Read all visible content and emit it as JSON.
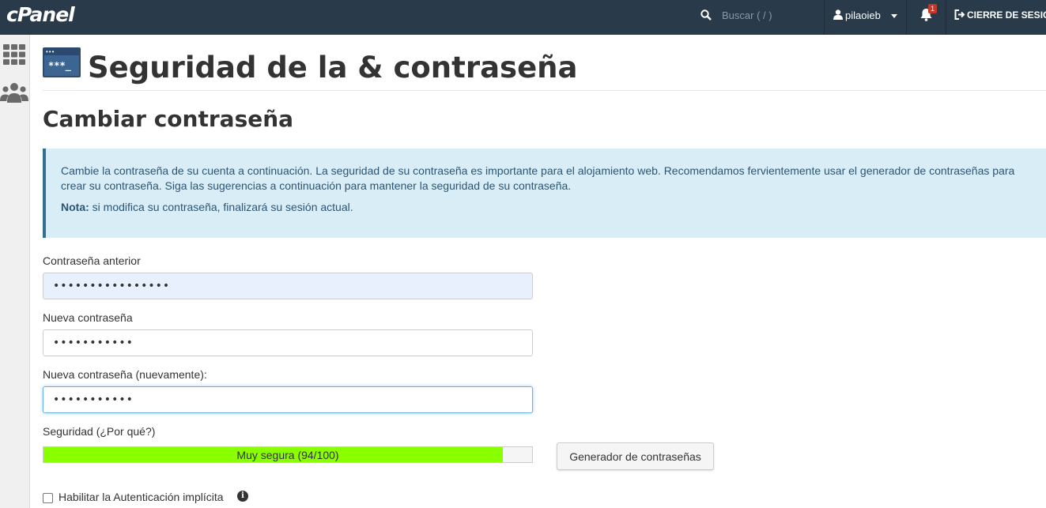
{
  "topbar": {
    "logo": "cPanel",
    "search_placeholder": "Buscar ( / )",
    "username": "pilaoieb",
    "notification_count": "1",
    "logout_label": "CIERRE DE SESIÓN"
  },
  "sidebar": {
    "icons": [
      "grid-icon",
      "users-icon"
    ]
  },
  "page": {
    "title": "Seguridad de la & contraseña",
    "section_title": "Cambiar contraseña",
    "info_text": "Cambie la contraseña de su cuenta a continuación. La seguridad de su contraseña es importante para el alojamiento web. Recomendamos fervientemente usar el generador de contraseñas para crear su contraseña. Siga las sugerencias a continuación para mantener la seguridad de su contraseña.",
    "note_label": "Nota:",
    "note_text": " si modifica su contraseña, finalizará su sesión actual."
  },
  "form": {
    "old_password_label": "Contraseña anterior",
    "old_password_value": "••••••••••••••••",
    "new_password_label": "Nueva contraseña",
    "new_password_value": "•••••••••••",
    "confirm_password_label": "Nueva contraseña (nuevamente):",
    "confirm_password_value": "•••••••••••",
    "strength_label": "Seguridad (¿Por qué?)",
    "strength_text": "Muy segura (94/100)",
    "strength_value": 94,
    "strength_color": "#8aff00",
    "generator_button": "Generador de contraseñas",
    "digest_auth_label": "Habilitar la Autenticación implícita",
    "digest_auth_checked": false
  },
  "colors": {
    "topbar": "#293a4a",
    "info_bg": "#d9edf7",
    "info_border": "#31708f"
  }
}
